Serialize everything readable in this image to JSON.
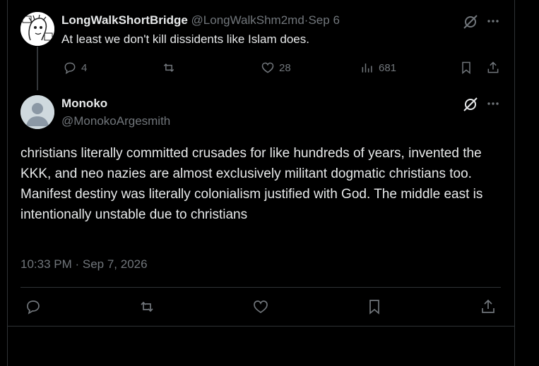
{
  "parent_tweet": {
    "display_name": "LongWalkShortBridge",
    "handle": "@LongWalkShm2md",
    "separator": "·",
    "date": "Sep 6",
    "text": "At least we don't kill dissidents like Islam does.",
    "actions": {
      "replies": "4",
      "likes": "28",
      "views": "681"
    }
  },
  "main_tweet": {
    "display_name": "Monoko",
    "handle": "@MonokoArgesmith",
    "text": "christians literally committed crusades for like hundreds of years, invented the KKK, and neo nazies are almost exclusively militant dogmatic christians too. Manifest destiny was literally colonialism justified with God. The middle east is intentionally unstable due to christians",
    "timestamp": "10:33 PM · Sep 7, 2026"
  },
  "colors": {
    "background": "#000000",
    "text_primary": "#e7e9ea",
    "text_secondary": "#71767b",
    "border": "#2f3336"
  },
  "icons": [
    "avatar-sketch",
    "grok-icon",
    "more-icon",
    "reply-icon",
    "repost-icon",
    "like-icon",
    "views-icon",
    "bookmark-icon",
    "share-icon",
    "default-avatar"
  ]
}
